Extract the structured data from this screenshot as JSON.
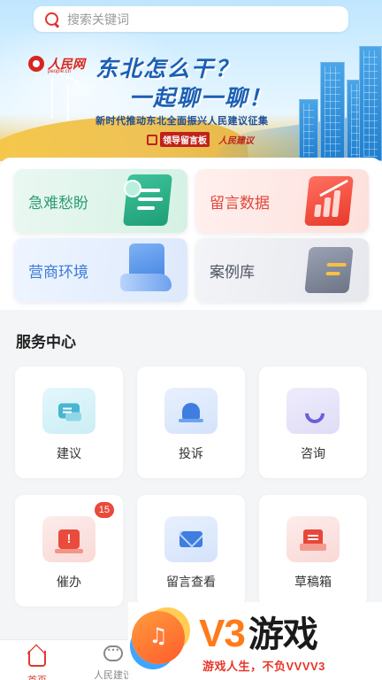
{
  "search": {
    "placeholder": "搜索关键词"
  },
  "banner": {
    "logo_cn": "人民网",
    "logo_en": "people.cn",
    "headline_line1": "东北怎么干？",
    "headline_line2": "一起聊一聊！",
    "tagline": "新时代推动东北全面振兴人民建议征集",
    "partner_1": "领导留言板",
    "partner_2": "人民建议"
  },
  "features": [
    {
      "label": "急难愁盼",
      "icon": "document-clock-icon",
      "color": "#2e9c76"
    },
    {
      "label": "留言数据",
      "icon": "chart-board-icon",
      "color": "#e0473a"
    },
    {
      "label": "营商环境",
      "icon": "clipboard-hand-icon",
      "color": "#3c7ad6"
    },
    {
      "label": "案例库",
      "icon": "folder-icon",
      "color": "#4f5664"
    }
  ],
  "service_center": {
    "title": "服务中心",
    "items": [
      {
        "label": "建议",
        "icon": "chat-bubbles-icon"
      },
      {
        "label": "投诉",
        "icon": "alarm-light-icon"
      },
      {
        "label": "咨询",
        "icon": "phone-icon"
      },
      {
        "label": "催办",
        "icon": "urge-warning-icon",
        "badge": "15"
      },
      {
        "label": "留言查看",
        "icon": "mail-icon"
      },
      {
        "label": "草稿箱",
        "icon": "draft-box-icon"
      }
    ]
  },
  "bottom_nav": {
    "items": [
      {
        "label": "首页",
        "icon": "home-icon",
        "active": true
      },
      {
        "label": "人民建议",
        "icon": "chat-bubble-icon",
        "active": false
      }
    ]
  },
  "watermark": {
    "brand": "V3",
    "brand_cn": "游戏",
    "slogan": "游戏人生，不负VVVV3"
  },
  "colors": {
    "accent_red": "#e0392b",
    "banner_blue": "#1b5fb4",
    "page_bg": "#f4f5f7"
  }
}
